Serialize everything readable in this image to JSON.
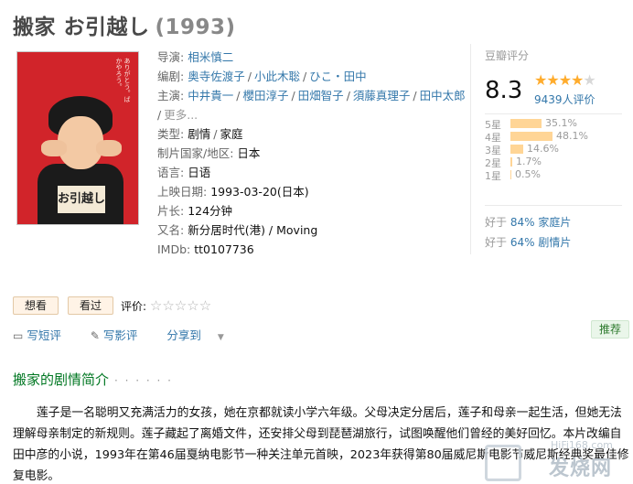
{
  "title": {
    "name": "搬家 お引越し",
    "year": "(1993)"
  },
  "poster": {
    "sign_text": "お引越し",
    "top_text": "ありがとう。ばかやろう。"
  },
  "info": {
    "director_label": "导演:",
    "director": "相米慎二",
    "writers_label": "编剧:",
    "writers": [
      "奥寺佐渡子",
      "小此木聡",
      "ひこ・田中"
    ],
    "cast_label": "主演:",
    "cast": [
      "中井貴一",
      "櫻田淳子",
      "田畑智子",
      "須藤真理子",
      "田中太郎"
    ],
    "cast_more": "更多...",
    "genre_label": "类型:",
    "genres": [
      "剧情",
      "家庭"
    ],
    "country_label": "制片国家/地区:",
    "country": "日本",
    "language_label": "语言:",
    "language": "日语",
    "release_label": "上映日期:",
    "release": "1993-03-20(日本)",
    "runtime_label": "片长:",
    "runtime": "124分钟",
    "aka_label": "又名:",
    "aka": "新分居时代(港) / Moving",
    "imdb_label": "IMDb:",
    "imdb": "tt0107736"
  },
  "rating": {
    "label": "豆瓣评分",
    "score": "8.3",
    "stars_filled": 4,
    "stars_total": 5,
    "count": "9439人评价",
    "bars": [
      {
        "level": "5星",
        "percent": 35.1,
        "percent_label": "35.1%"
      },
      {
        "level": "4星",
        "percent": 48.1,
        "percent_label": "48.1%"
      },
      {
        "level": "3星",
        "percent": 14.6,
        "percent_label": "14.6%"
      },
      {
        "level": "2星",
        "percent": 1.7,
        "percent_label": "1.7%"
      },
      {
        "level": "1星",
        "percent": 0.5,
        "percent_label": "0.5%"
      }
    ],
    "better_than": [
      {
        "prefix": "好于",
        "value": "84% 家庭片"
      },
      {
        "prefix": "好于",
        "value": "64% 剧情片"
      }
    ]
  },
  "actions": {
    "want_label": "想看",
    "seen_label": "看过",
    "rate_label": "评价:",
    "write_short": "写短评",
    "write_review": "写影评",
    "share": "分享到",
    "recommend": "推荐"
  },
  "intro": {
    "title": "搬家的剧情简介",
    "dots": "· · · · · ·",
    "text": "莲子是一名聪明又充满活力的女孩，她在京都就读小学六年级。父母决定分居后，莲子和母亲一起生活，但她无法理解母亲制定的新规则。莲子藏起了离婚文件，还安排父母到琵琶湖旅行，试图唤醒他们曾经的美好回忆。本片改编自田中彦的小说，1993年在第46届戛纳电影节一种关注单元首映，2023年获得第80届威尼斯电影节威尼斯经典奖最佳修复电影。"
  },
  "watermark": {
    "site": "发烧网",
    "url": "HiFi168.com"
  },
  "colors": {
    "link": "#3377aa",
    "star": "#ffac2d",
    "bar": "#ffd596",
    "intro_title": "#007722"
  }
}
